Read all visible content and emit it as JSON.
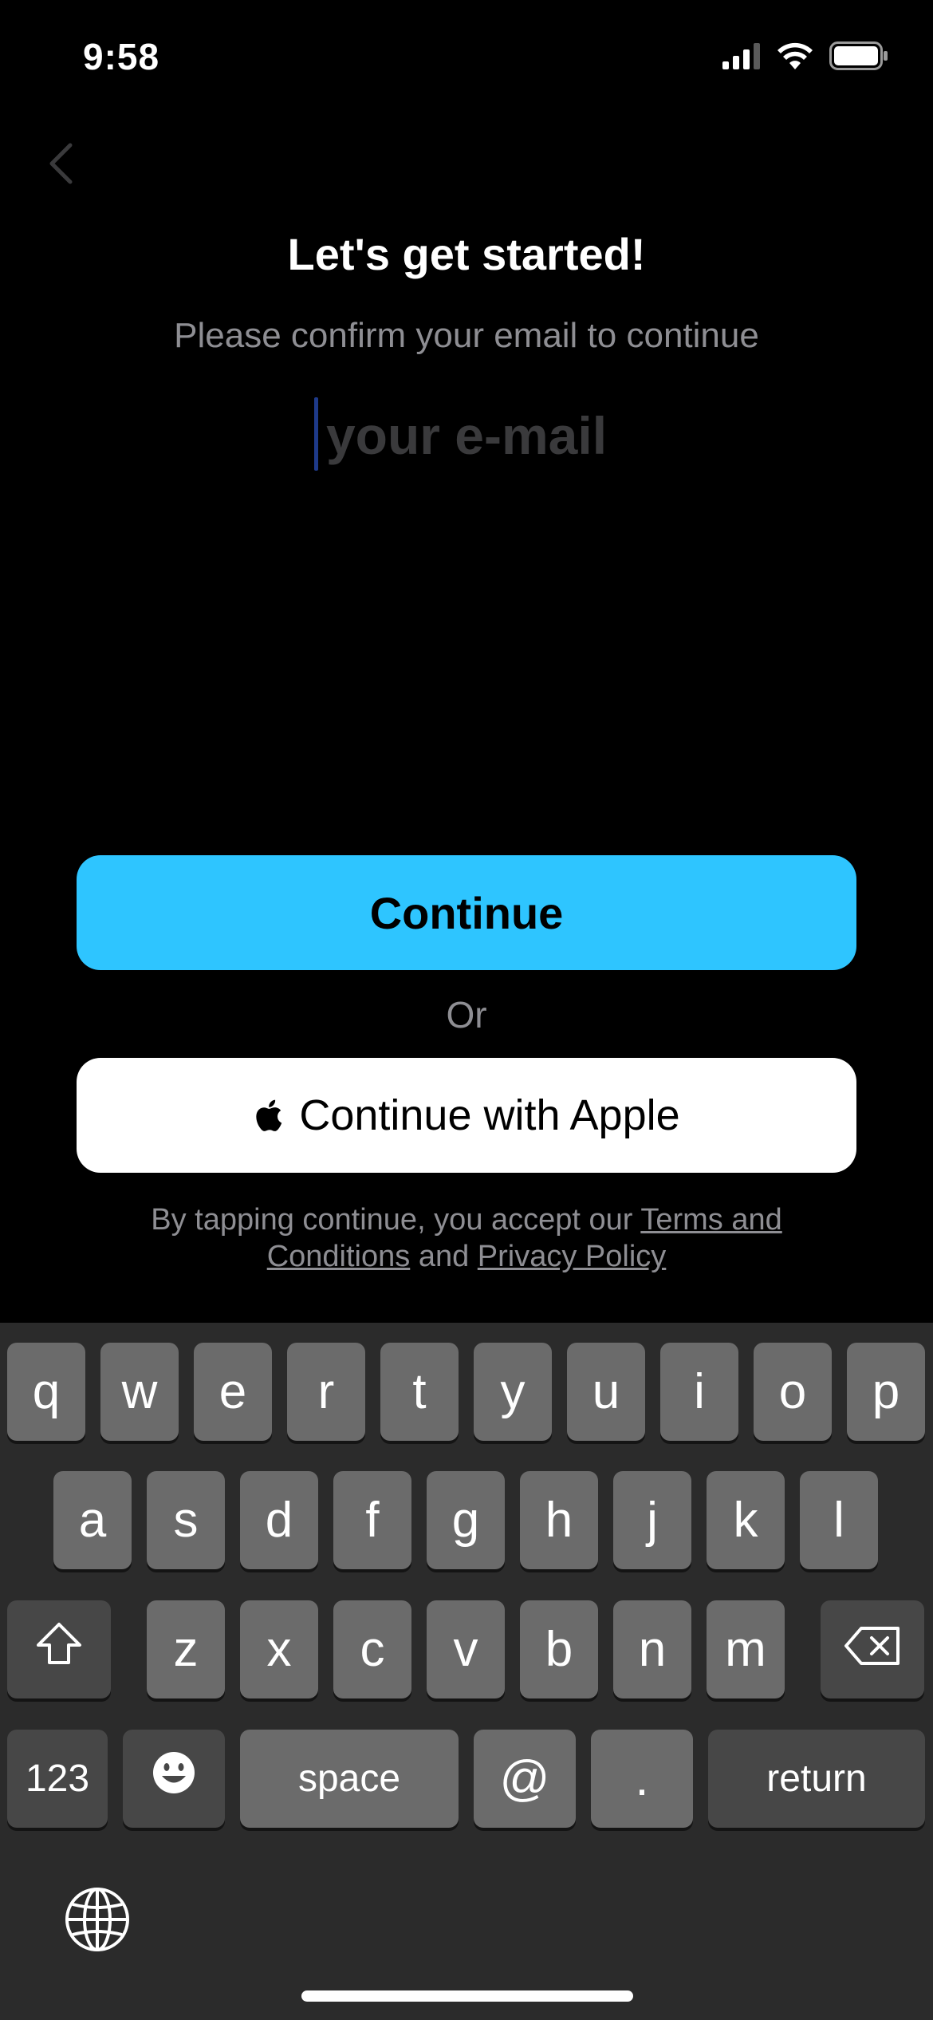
{
  "status_bar": {
    "time": "9:58"
  },
  "header": {
    "title": "Let's get started!",
    "subtitle": "Please confirm your email to continue"
  },
  "email": {
    "placeholder": "your e-mail",
    "value": ""
  },
  "buttons": {
    "continue": "Continue",
    "or": "Or",
    "apple": "Continue with Apple"
  },
  "terms": {
    "prefix": "By tapping continue, you accept our ",
    "terms_link": "Terms and Conditions",
    "middle": " and ",
    "privacy_link": "Privacy Policy"
  },
  "keyboard": {
    "row1": [
      "q",
      "w",
      "e",
      "r",
      "t",
      "y",
      "u",
      "i",
      "o",
      "p"
    ],
    "row2": [
      "a",
      "s",
      "d",
      "f",
      "g",
      "h",
      "j",
      "k",
      "l"
    ],
    "row3": [
      "z",
      "x",
      "c",
      "v",
      "b",
      "n",
      "m"
    ],
    "numbers": "123",
    "space": "space",
    "at": "@",
    "dot": ".",
    "return": "return"
  },
  "colors": {
    "accent": "#2ec5ff",
    "background": "#000000",
    "keyboard_bg": "#2b2b2b",
    "key": "#6b6b6b"
  }
}
